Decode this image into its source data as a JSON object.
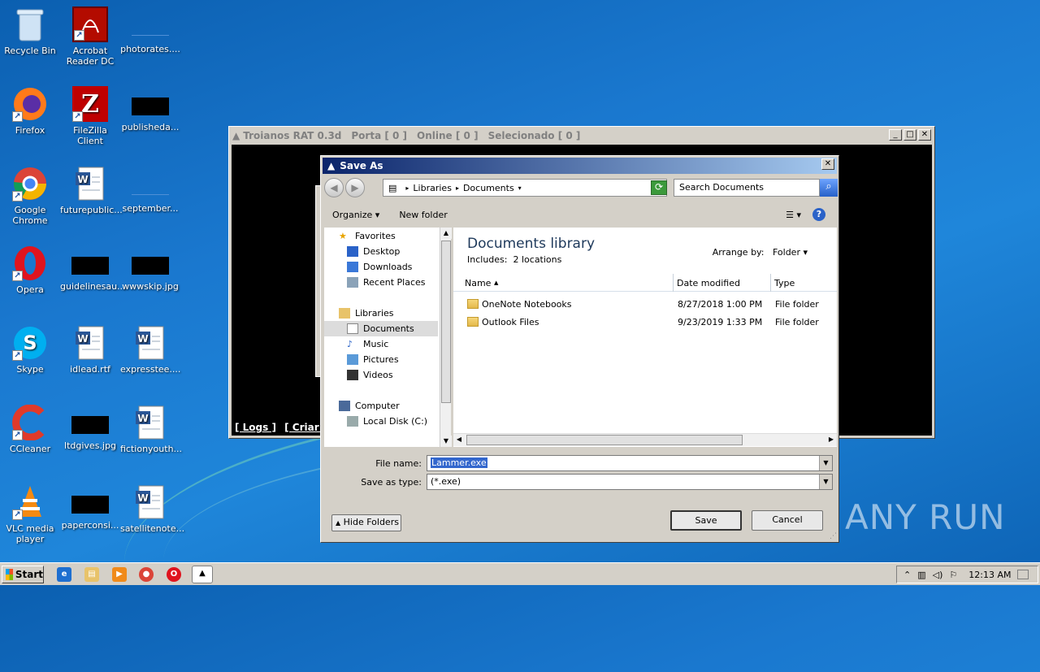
{
  "desktop": {
    "icons": [
      {
        "label": "Recycle Bin"
      },
      {
        "label": "Acrobat Reader DC"
      },
      {
        "label": "photorates...."
      },
      {
        "label": "Firefox"
      },
      {
        "label": "FileZilla Client"
      },
      {
        "label": "publisheda..."
      },
      {
        "label": "Google Chrome"
      },
      {
        "label": "futurepublic..."
      },
      {
        "label": "september..."
      },
      {
        "label": "Opera"
      },
      {
        "label": "guidelinesau..."
      },
      {
        "label": "wwwskip.jpg"
      },
      {
        "label": "Skype"
      },
      {
        "label": "idlead.rtf"
      },
      {
        "label": "expresstee...."
      },
      {
        "label": "CCleaner"
      },
      {
        "label": "ltdgives.jpg"
      },
      {
        "label": "fictionyouth..."
      },
      {
        "label": "VLC media player"
      },
      {
        "label": "paperconsi..."
      },
      {
        "label": "satellitenote..."
      }
    ]
  },
  "rat_window": {
    "title": "Troianos RAT 0.3d",
    "porta": "Porta [ 0 ]",
    "online": "Online [ 0 ]",
    "selecionado": "Selecionado [ 0 ]",
    "link_logs": "[ Logs ]",
    "link_criar": "[ Criar Ser"
  },
  "dialog": {
    "title": "Save As",
    "address": {
      "root": "Libraries",
      "current": "Documents"
    },
    "search_placeholder": "Search Documents",
    "toolbar": {
      "organize": "Organize",
      "new_folder": "New folder"
    },
    "nav": {
      "favorites": "Favorites",
      "desktop": "Desktop",
      "downloads": "Downloads",
      "recent": "Recent Places",
      "libraries": "Libraries",
      "documents": "Documents",
      "music": "Music",
      "pictures": "Pictures",
      "videos": "Videos",
      "computer": "Computer",
      "local_disk": "Local Disk (C:)"
    },
    "library_title": "Documents library",
    "library_includes": "Includes:",
    "library_locations": "2 locations",
    "arrange_label": "Arrange by:",
    "arrange_value": "Folder",
    "columns": {
      "name": "Name",
      "date": "Date modified",
      "type": "Type"
    },
    "files": [
      {
        "name": "OneNote Notebooks",
        "date": "8/27/2018 1:00 PM",
        "type": "File folder"
      },
      {
        "name": "Outlook Files",
        "date": "9/23/2019 1:33 PM",
        "type": "File folder"
      }
    ],
    "file_name_label": "File name:",
    "file_name_value": "Lammer.exe",
    "save_type_label": "Save as type:",
    "save_type_value": "(*.exe)",
    "hide_folders": "Hide Folders",
    "save_button": "Save",
    "cancel_button": "Cancel"
  },
  "taskbar": {
    "start": "Start",
    "clock": "12:13 AM"
  },
  "watermark": "ANY RUN"
}
